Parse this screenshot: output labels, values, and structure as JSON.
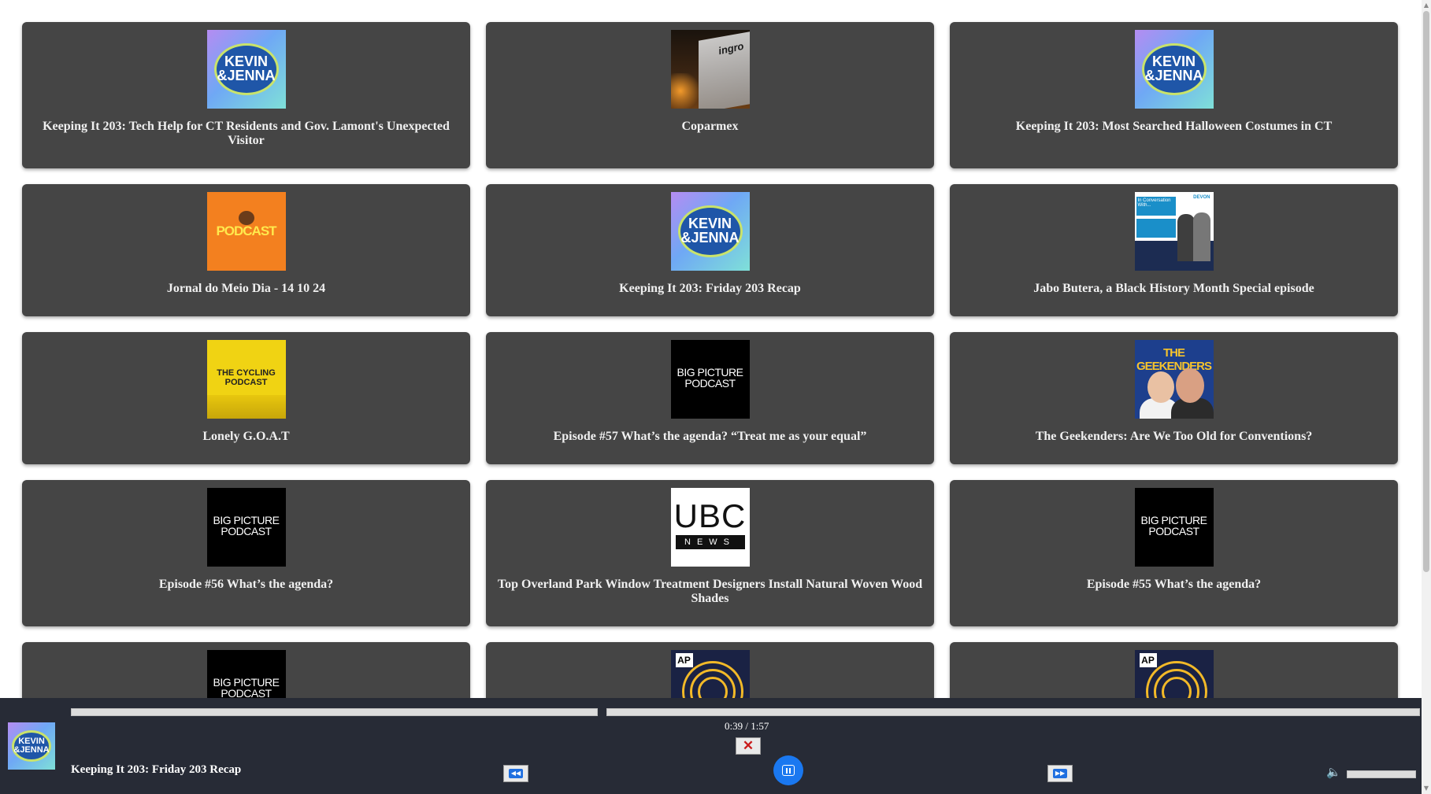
{
  "cards": [
    {
      "title": "Keeping It 203: Tech Help for CT Residents and Gov. Lamont's Unexpected Visitor",
      "art": "kevin-jenna",
      "art_text": [
        "KEVIN",
        "&JENNA"
      ]
    },
    {
      "title": "Coparmex",
      "art": "coparmex",
      "art_text": [
        "ingro"
      ]
    },
    {
      "title": "Keeping It 203: Most Searched Halloween Costumes in CT",
      "art": "kevin-jenna",
      "art_text": [
        "KEVIN",
        "&JENNA"
      ]
    },
    {
      "title": "Jornal do Meio Dia - 14 10 24",
      "art": "podcast-orange",
      "art_text": [
        "PODCAST"
      ]
    },
    {
      "title": "Keeping It 203: Friday 203 Recap",
      "art": "kevin-jenna",
      "art_text": [
        "KEVIN",
        "&JENNA"
      ]
    },
    {
      "title": "Jabo Butera, a Black History Month Special episode",
      "art": "devon",
      "art_text": [
        "In Conversation With...",
        "DEVON"
      ]
    },
    {
      "title": "Lonely G.O.A.T",
      "art": "cycling",
      "art_text": [
        "THE CYCLING",
        "PODCAST"
      ]
    },
    {
      "title": "Episode #57 What’s the agenda? “Treat me as your equal”",
      "art": "big-picture",
      "art_text": [
        "BIG PICTURE",
        "PODCAST"
      ]
    },
    {
      "title": "The Geekenders: Are We Too Old for Conventions?",
      "art": "geekenders",
      "art_text": [
        "THE GEEKENDERS"
      ]
    },
    {
      "title": "Episode #56 What’s the agenda?",
      "art": "big-picture",
      "art_text": [
        "BIG PICTURE",
        "PODCAST"
      ]
    },
    {
      "title": "Top Overland Park Window Treatment Designers Install Natural Woven Wood Shades",
      "art": "ubc",
      "art_text": [
        "UBC",
        "NEWS"
      ]
    },
    {
      "title": "Episode #55 What’s the agenda?",
      "art": "big-picture",
      "art_text": [
        "BIG PICTURE",
        "PODCAST"
      ]
    },
    {
      "title": "",
      "art": "big-picture",
      "art_text": [
        "BIG PICTURE",
        "PODCAST"
      ]
    },
    {
      "title": "",
      "art": "ap",
      "art_text": [
        "AP"
      ]
    },
    {
      "title": "",
      "art": "ap",
      "art_text": [
        "AP"
      ]
    }
  ],
  "player": {
    "now_playing_title": "Keeping It 203: Friday 203 Recap",
    "time": "0:39 / 1:57",
    "progress_fraction": 0.333,
    "close_icon": "close-x-icon",
    "rewind_icon": "rewind-icon",
    "pause_icon": "pause-icon",
    "forward_icon": "fast-forward-icon",
    "volume_icon": "speaker-icon",
    "volume_level": 1.0,
    "accent_color": "#1a78f0"
  },
  "colors": {
    "card_bg": "#454545",
    "player_bg": "#272b36",
    "page_bg": "#ffffff"
  }
}
